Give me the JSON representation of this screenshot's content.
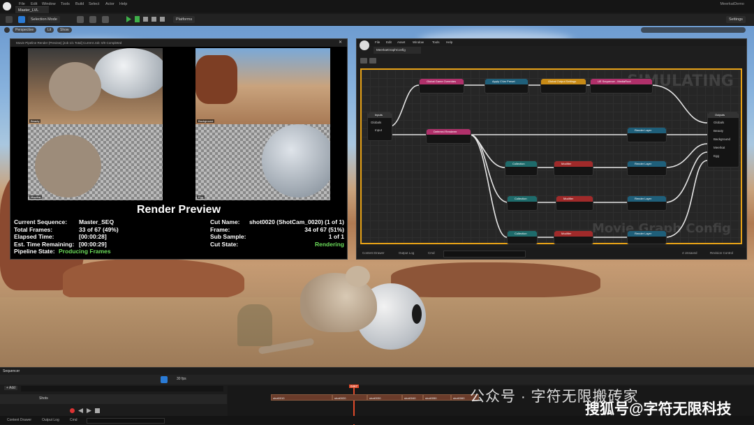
{
  "menubar": {
    "level_tab": "Master_LVL",
    "menus": [
      "File",
      "Edit",
      "Window",
      "Tools",
      "Build",
      "Select",
      "Actor",
      "Help"
    ],
    "project": "MeerkatDemo"
  },
  "toolbar": {
    "save_label": "",
    "mode": "Selection Mode",
    "platforms": "Platforms",
    "settings": "Settings"
  },
  "viewport_bar": {
    "perspective": "Perspective",
    "lit": "Lit",
    "show": "Show"
  },
  "render_window": {
    "title": "Movie Pipeline Render (Preview) [Job 1/1 Total] Current Job: 0/0 Completed",
    "thumb_labels": [
      "Beauty",
      "Background",
      "Meerkat",
      "Egg"
    ],
    "heading": "Render Preview",
    "left_stats": [
      {
        "label": "Current Sequence:",
        "value": "Master_SEQ"
      },
      {
        "label": "Total Frames:",
        "value": "33 of 67 (49%)"
      },
      {
        "label": "Elapsed Time:",
        "value": "[00:00:28]"
      },
      {
        "label": "Est. Time Remaining:",
        "value": "[00:00:29]"
      },
      {
        "label": "Pipeline State:",
        "value": "Producing Frames"
      }
    ],
    "right_stats": [
      {
        "label": "Cut Name:",
        "value": "shot0020 (ShotCam_0020) (1 of 1)"
      },
      {
        "label": "Frame:",
        "value": "34 of 67 (51%)"
      },
      {
        "label": "Sub Sample:",
        "value": "1 of 1"
      },
      {
        "label": "Cut State:",
        "value": "Rendering"
      }
    ]
  },
  "graph_window": {
    "menus": [
      "File",
      "Edit",
      "Asset",
      "Window",
      "Tools",
      "Help"
    ],
    "tab": "MeerkatGraphConfig",
    "simulating": "SIMULATING",
    "watermark": "Movie Graph Config",
    "nodes": {
      "global_game": "Global Game Overrides",
      "apply_cvar": "Apply CVar Preset",
      "global_output": "Global Output Settings",
      "ue_sequence": "UE Sequence - MediaRoot",
      "deferred": "Deferred Renderer",
      "inputs": "Inputs",
      "outputs": "Outputs",
      "render_layer": "Render Layer",
      "collection": "Collection",
      "modifier": "Modifier"
    },
    "input_pins": [
      "Globals",
      "Input"
    ],
    "output_pins": [
      "Globals",
      "Beauty",
      "Background",
      "Meerkat",
      "Egg"
    ],
    "bottom": {
      "content_drawer": "Content Drawer",
      "output_log": "Output Log",
      "cmd": "Cmd",
      "unsaved": "4 Unsaved",
      "revision": "Revision Control"
    }
  },
  "sequencer": {
    "tab": "Sequencer",
    "add": "+ Add",
    "track": "Shots",
    "frame": "0467",
    "fps": "30 fps",
    "shots": [
      "shot0010",
      "shot0020",
      "shot0030",
      "shot0040",
      "shot0050",
      "shot0060"
    ]
  },
  "statusbar": {
    "content_drawer": "Content Drawer",
    "output_log": "Output Log",
    "cmd": "Cmd",
    "unsaved": "1 Unsaved",
    "revision": "Revision Control"
  },
  "watermark": {
    "line1": "公众号 · 字符无限搬砖家",
    "line2": "搜狐号@字符无限科技"
  },
  "colors": {
    "accent_orange": "#e8a317",
    "node_pink": "#b0306a",
    "node_blue": "#1f5f7a",
    "node_red": "#a02a2a",
    "state_green": "#6cdc5a"
  }
}
